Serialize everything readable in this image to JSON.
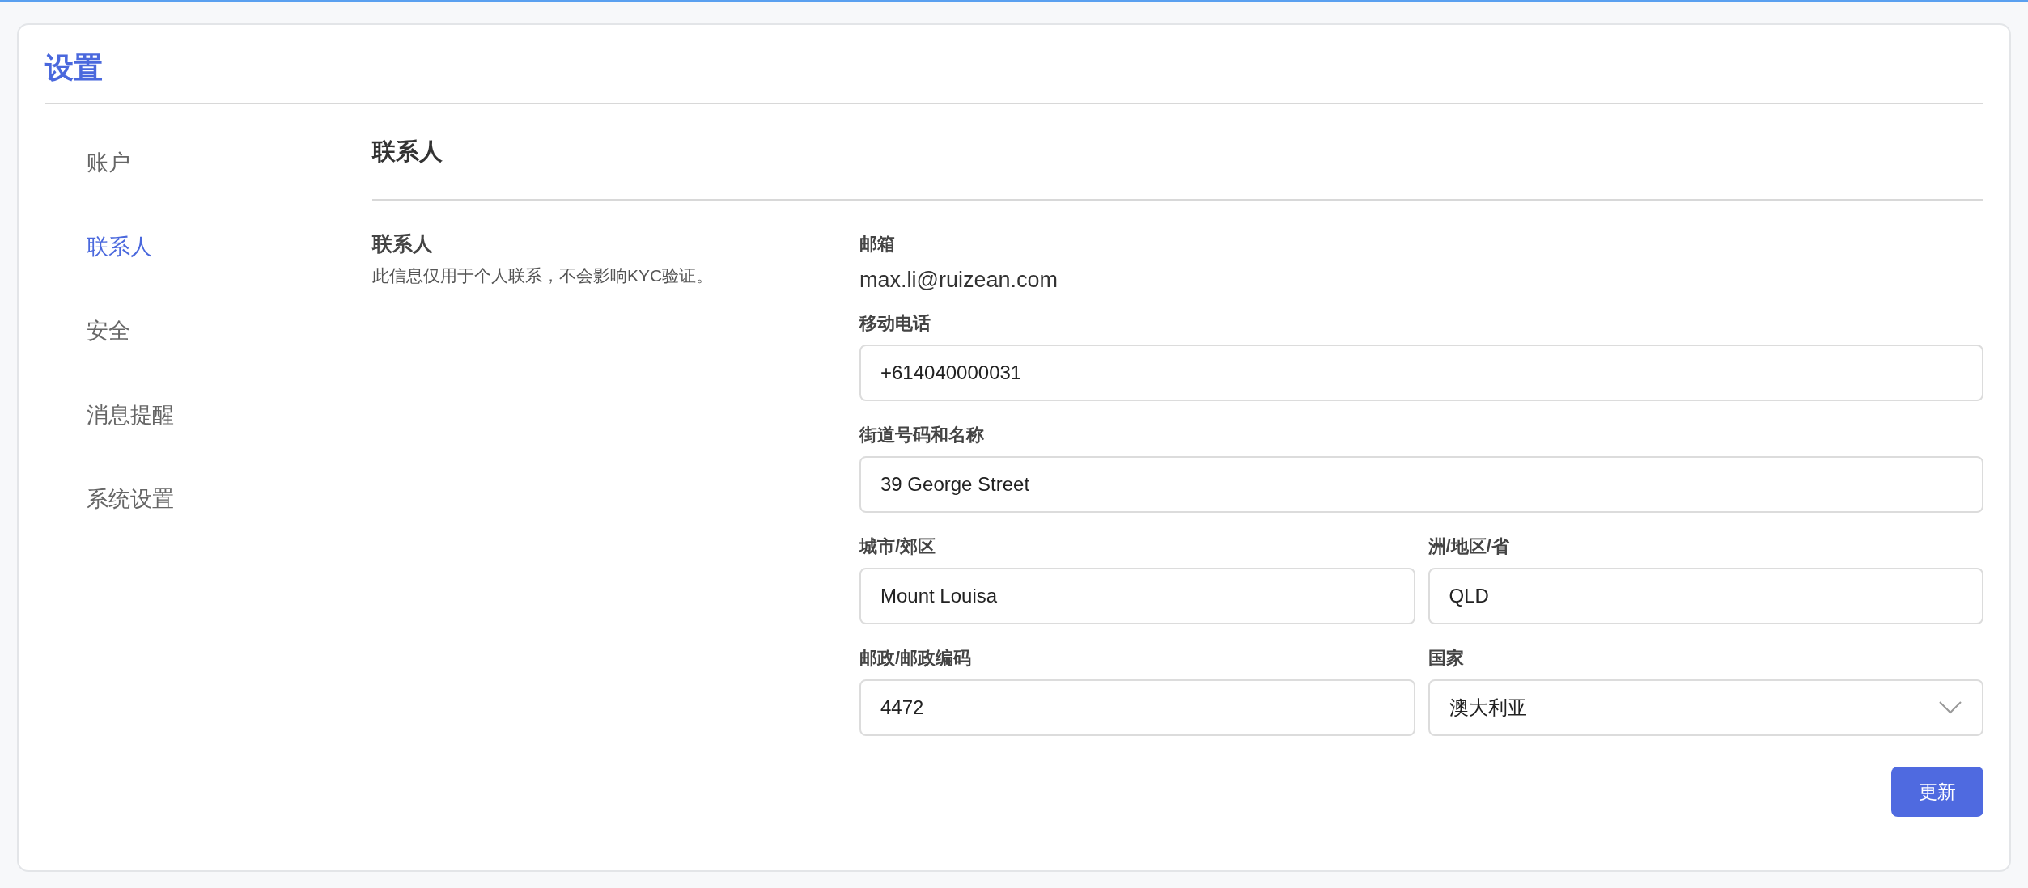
{
  "title": "设置",
  "sidebar": {
    "items": [
      {
        "label": "账户",
        "selected": false
      },
      {
        "label": "联系人",
        "selected": true
      },
      {
        "label": "安全",
        "selected": false
      },
      {
        "label": "消息提醒",
        "selected": false
      },
      {
        "label": "系统设置",
        "selected": false
      }
    ]
  },
  "section": {
    "heading": "联系人",
    "subheading": "联系人",
    "description": "此信息仅用于个人联系，不会影响KYC验证。"
  },
  "email": {
    "label": "邮箱",
    "value": "max.li@ruizean.com"
  },
  "rows": [
    [
      {
        "kind": "input",
        "label": "移动电话",
        "value": "+614040000031"
      }
    ],
    [
      {
        "kind": "input",
        "label": "街道号码和名称",
        "value": "39 George Street"
      }
    ],
    [
      {
        "kind": "input",
        "label": "城市/郊区",
        "value": "Mount Louisa"
      },
      {
        "kind": "input",
        "label": "洲/地区/省",
        "value": "QLD"
      }
    ],
    [
      {
        "kind": "input",
        "label": "邮政/邮政编码",
        "value": "4472"
      },
      {
        "kind": "select",
        "label": "国家",
        "value": "澳大利亚"
      }
    ]
  ],
  "update_button": "更新"
}
